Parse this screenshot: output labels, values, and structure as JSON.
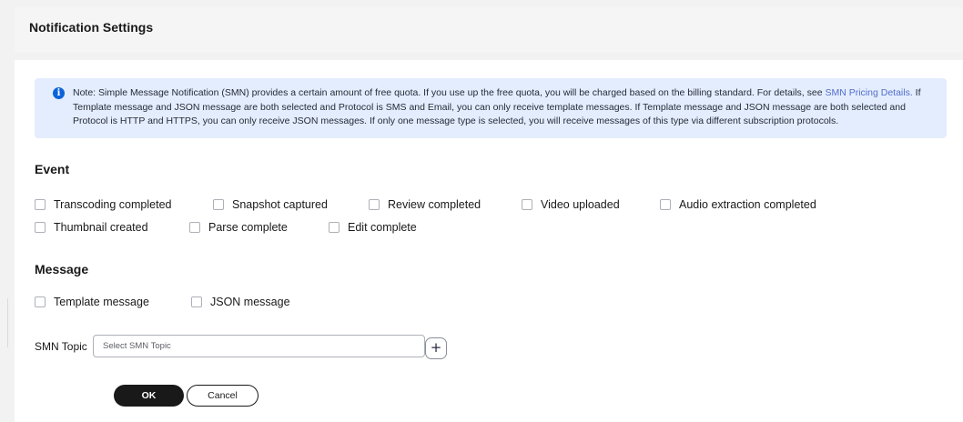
{
  "header": {
    "title": "Notification Settings"
  },
  "notice": {
    "text_part1": "Note: Simple Message Notification (SMN) provides a certain amount of free quota. If you use up the free quota, you will be charged based on the billing standard. For details, see ",
    "link": "SMN Pricing Details.",
    "text_part2": " If Template message and JSON message are both selected and Protocol is SMS and Email, you can only receive template messages. If Template message and JSON message are both selected and Protocol is HTTP and HTTPS, you can only receive JSON messages. If only one message type is selected, you will receive messages of this type via different subscription protocols."
  },
  "event": {
    "title": "Event",
    "options": [
      {
        "label": "Transcoding completed",
        "checked": false
      },
      {
        "label": "Snapshot captured",
        "checked": false
      },
      {
        "label": "Review completed",
        "checked": false
      },
      {
        "label": "Video uploaded",
        "checked": false
      },
      {
        "label": "Audio extraction completed",
        "checked": false
      },
      {
        "label": "Thumbnail created",
        "checked": false
      },
      {
        "label": "Parse complete",
        "checked": false
      },
      {
        "label": "Edit complete",
        "checked": false
      }
    ]
  },
  "message": {
    "title": "Message",
    "options": [
      {
        "label": "Template message",
        "checked": false
      },
      {
        "label": "JSON message",
        "checked": false
      }
    ]
  },
  "smn_topic": {
    "label": "SMN Topic",
    "value": "",
    "placeholder": "Select SMN Topic",
    "add_label": "+"
  },
  "actions": {
    "ok_label": "OK",
    "cancel_label": "Cancel"
  },
  "colors": {
    "primary_button": "#191919",
    "notice_background": "#e4edfd",
    "info_icon": "#0c63d9",
    "link": "#526ecc",
    "checkbox_border": "#adb0b8"
  }
}
